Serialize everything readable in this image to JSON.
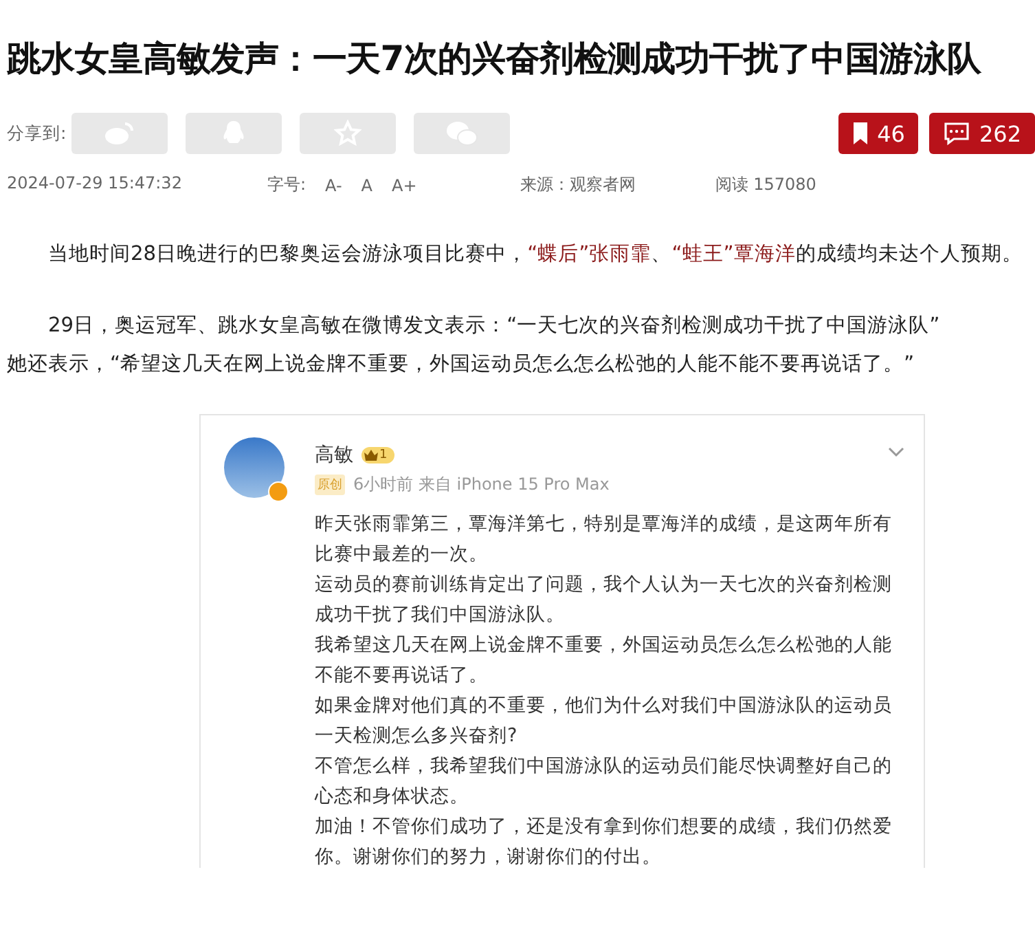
{
  "article": {
    "title": "跳水女皇高敏发声：一天7次的兴奋剂检测成功干扰了中国游泳队",
    "share_label": "分享到:",
    "share_buttons": [
      {
        "kind": "weibo"
      },
      {
        "kind": "qq"
      },
      {
        "kind": "favorite"
      },
      {
        "kind": "wechat"
      }
    ],
    "counters": [
      {
        "kind": "bookmark",
        "count": "46"
      },
      {
        "kind": "comment",
        "count": "262"
      }
    ],
    "meta": {
      "datetime": "2024-07-29 15:47:32",
      "font_size_label": "字号:",
      "font_sizes": [
        "A-",
        "A",
        "A+"
      ],
      "source": "来源：观察者网",
      "reads": "阅读 157080"
    },
    "paragraphs": [
      [
        {
          "kind": "text",
          "text": "当地时间28日晚进行的巴黎奥运会游泳项目比赛中，"
        },
        {
          "kind": "link",
          "text": "“蝶后”张雨霏"
        },
        {
          "kind": "text",
          "text": "、"
        },
        {
          "kind": "link",
          "text": "“蛙王”覃海洋"
        },
        {
          "kind": "text",
          "text": "的成绩均未达个人预期。"
        }
      ],
      [
        {
          "kind": "text",
          "text": "29日，奥运冠军、跳水女皇高敏在微博发文表示：“一天七次的兴奋剂检测成功干扰了中国游泳队”"
        }
      ],
      [
        {
          "kind": "text",
          "text": "她还表示，“希望这几天在网上说金牌不重要，外国运动员怎么怎么松弛的人能不能不要再说话了。”"
        }
      ]
    ],
    "post": {
      "author": "高敏",
      "badge_level": "1",
      "tag": "原创",
      "time_source": "6小时前 来自 iPhone 15 Pro Max",
      "lines": [
        "昨天张雨霏第三，覃海洋第七，特别是覃海洋的成绩，是这两年所有比赛中最差的一次。",
        "运动员的赛前训练肯定出了问题，我个人认为一天七次的兴奋剂检测成功干扰了我们中国游泳队。",
        "我希望这几天在网上说金牌不重要，外国运动员怎么怎么松弛的人能不能不要再说话了。",
        "如果金牌对他们真的不重要，他们为什么对我们中国游泳队的运动员一天检测怎么多兴奋剂?",
        "不管怎么样，我希望我们中国游泳队的运动员们能尽快调整好自己的心态和身体状态。",
        "加油！不管你们成功了，还是没有拿到你们想要的成绩，我们仍然爱你。谢谢你们的努力，谢谢你们的付出。"
      ]
    }
  }
}
